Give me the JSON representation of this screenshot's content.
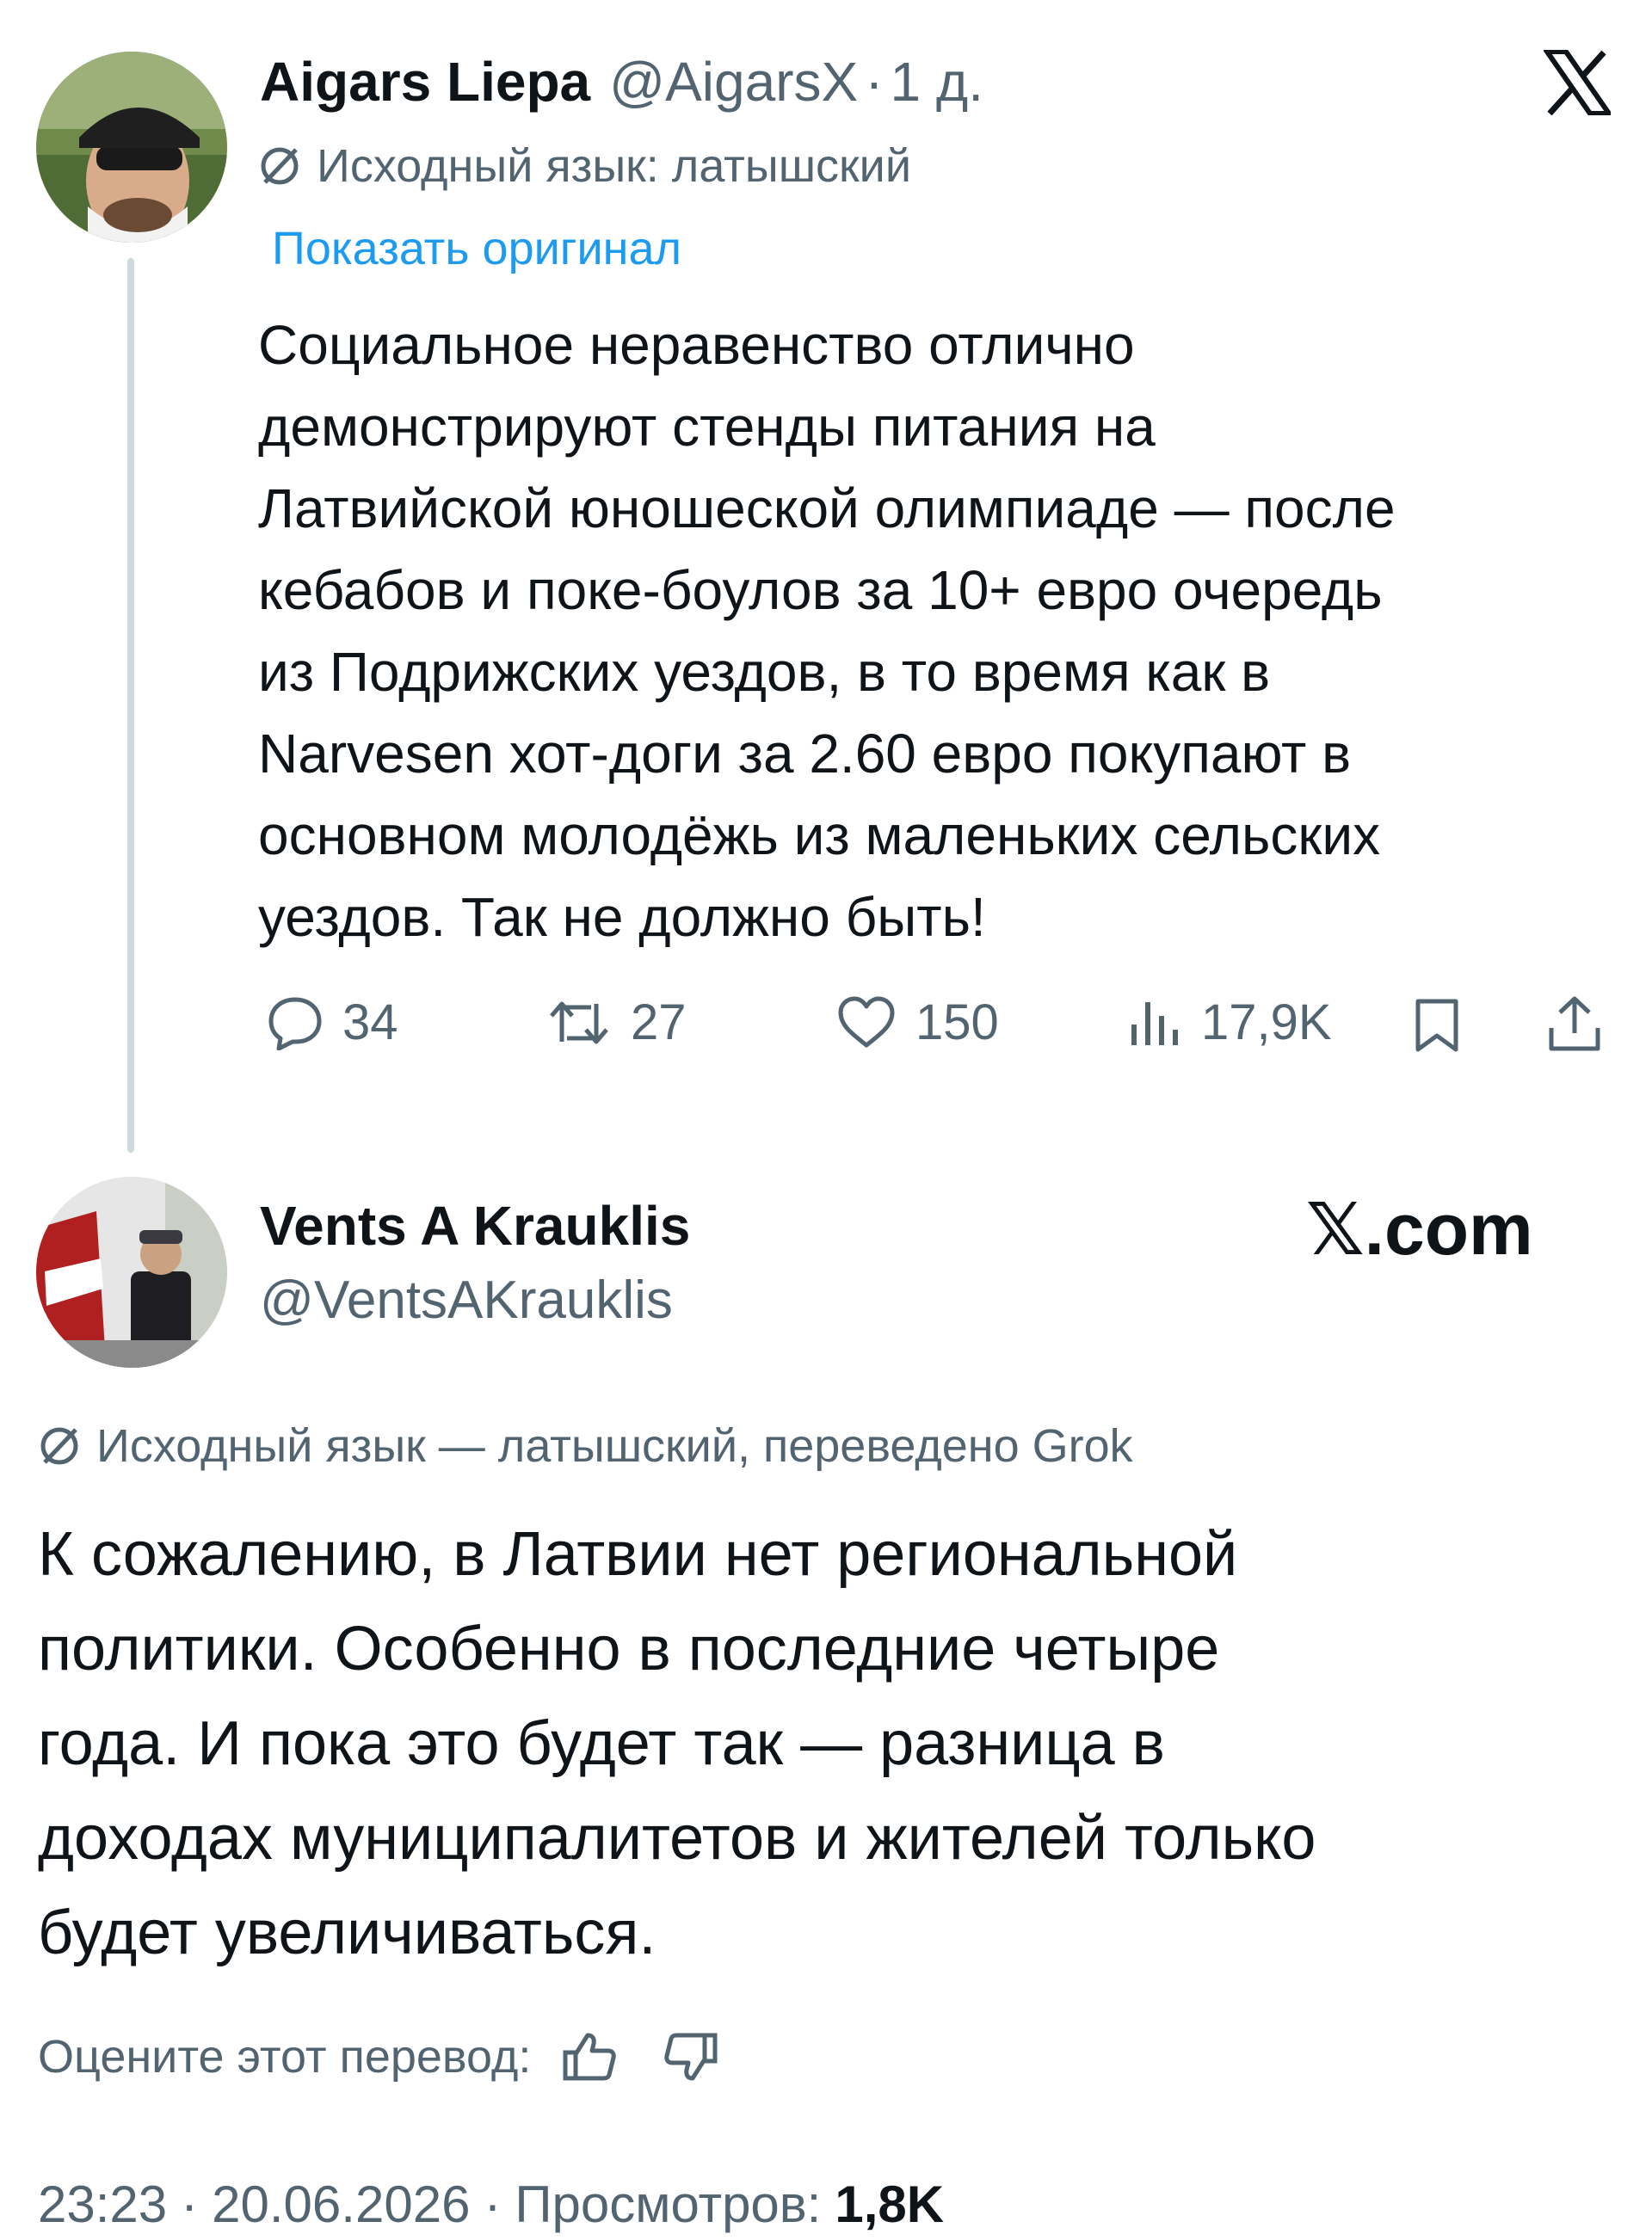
{
  "tweet1": {
    "author_name": "Aigars Liepa",
    "handle": "@AigarsX",
    "separator": "·",
    "time": "1 д.",
    "lang_note": "Исходный язык: латышский",
    "show_original": "Показать оригинал",
    "body_lines": [
      "Социальное неравенство отлично",
      "демонстрируют стенды питания на",
      "Латвийской юношеской олимпиаде — после",
      "кебабов и поке-боулов за 10+ евро очередь",
      "из Подрижских уездов, в то время как в",
      "Narvesen хот-доги за 2.60 евро покупают в",
      "основном молодёжь из маленьких сельских",
      "уездов. Так не должно быть!"
    ],
    "replies": "34",
    "reposts": "27",
    "likes": "150",
    "views": "17,9K"
  },
  "tweet2": {
    "author_name": "Vents A Krauklis",
    "handle": "@VentsAKrauklis",
    "lang_note": "Исходный язык — латышский, переведено Grok",
    "body_lines": [
      "К сожалению, в Латвии нет региональной",
      "политики. Особенно в последние четыре",
      "года. И пока это будет так — разница в",
      "доходах муниципалитетов и жителей только",
      "будет увеличиваться."
    ],
    "rate_translation": "Оцените этот перевод:",
    "time": "23:23",
    "dot": "·",
    "date": "20.06.2026",
    "views_label": "Просмотров:",
    "views_count": "1,8K"
  },
  "brand": {
    "x_logo": "𝕏",
    "watermark": "𝕏.com"
  },
  "colors": {
    "text": "#0f1419",
    "secondary": "#536471",
    "link": "#1d9bf0",
    "thread_line": "#cfd9de"
  },
  "icons": [
    "translate-icon",
    "reply-icon",
    "repost-icon",
    "like-icon",
    "views-icon",
    "bookmark-icon",
    "share-icon",
    "thumbs-up-icon",
    "thumbs-down-icon",
    "x-logo-icon"
  ]
}
